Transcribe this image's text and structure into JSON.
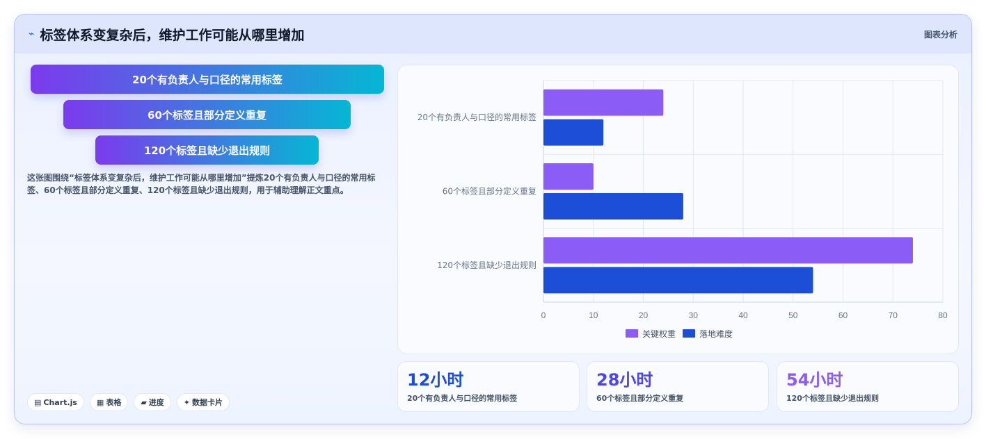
{
  "header": {
    "icon": "trend-line-icon",
    "title": "标签体系变复杂后，维护工作可能从哪里增加",
    "tag": "图表分析"
  },
  "steps": [
    "20个有负责人与口径的常用标签",
    "60个标签且部分定义重复",
    "120个标签且缺少退出规则"
  ],
  "description": "这张图围绕“标签体系变复杂后，维护工作可能从哪里增加”提炼20个有负责人与口径的常用标签、60个标签且部分定义重复、120个标签且缺少退出规则，用于辅助理解正文重点。",
  "tags": [
    {
      "icon": "chart-icon",
      "label": "Chart.js"
    },
    {
      "icon": "table-icon",
      "label": "表格"
    },
    {
      "icon": "progress-icon",
      "label": "进度"
    },
    {
      "icon": "sparkle-icon",
      "label": "数据卡片"
    }
  ],
  "stats": [
    {
      "value": "12小时",
      "label": "20个有负责人与口径的常用标签",
      "color": "#1d4ed8"
    },
    {
      "value": "28小时",
      "label": "60个标签且部分定义重复",
      "color": "#4f46e5"
    },
    {
      "value": "54小时",
      "label": "120个标签且缺少退出规则",
      "color": "#8b5cf6"
    }
  ],
  "chart_data": {
    "type": "bar",
    "orientation": "horizontal",
    "categories": [
      "20个有负责人与口径的常用标签",
      "60个标签且部分定义重复",
      "120个标签且缺少退出规则"
    ],
    "series": [
      {
        "name": "关键权重",
        "values": [
          24,
          10,
          74
        ],
        "color": "#8b5cf6"
      },
      {
        "name": "落地难度",
        "values": [
          12,
          28,
          54
        ],
        "color": "#1d4ed8"
      }
    ],
    "xlim": [
      0,
      80
    ],
    "xticks": [
      0,
      10,
      20,
      30,
      40,
      50,
      60,
      70,
      80
    ],
    "grid": true,
    "legend": "bottom"
  }
}
